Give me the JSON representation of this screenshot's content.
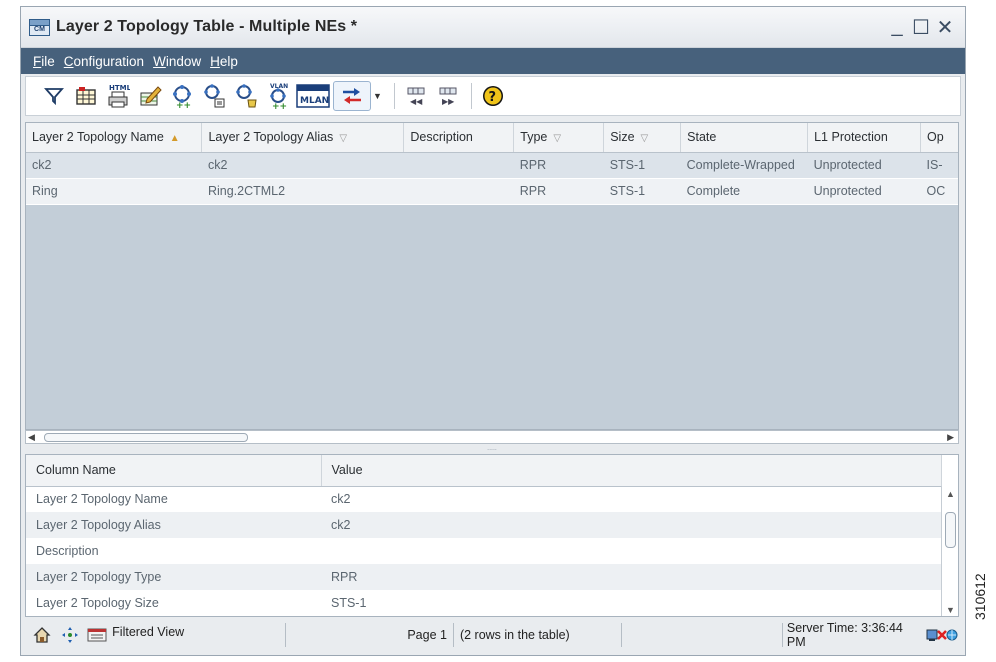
{
  "window": {
    "app_icon_text": "CM",
    "title": "Layer 2 Topology Table - Multiple NEs *",
    "controls": {
      "minimize": "_",
      "maximize": "☐",
      "close": "✕"
    }
  },
  "menu": [
    {
      "label": "File",
      "underline": "F"
    },
    {
      "label": "Configuration",
      "underline": "C"
    },
    {
      "label": "Window",
      "underline": "W"
    },
    {
      "label": "Help",
      "underline": "H"
    }
  ],
  "toolbar": {
    "html_label": "HTML",
    "vlan_label": "VLAN",
    "buttons": [
      "filter-icon",
      "table-icon",
      "html-print-icon",
      "edit-icon",
      "create-ring-icon",
      "ring-detail-icon",
      "ring-modify-icon",
      "vlan-create-icon",
      "mlan-icon",
      "transfer-icon",
      "collapse-columns-icon",
      "expand-columns-icon",
      "help-icon"
    ]
  },
  "topology_table": {
    "columns": [
      {
        "label": "Layer 2 Topology Name",
        "sort": "asc"
      },
      {
        "label": "Layer 2 Topology Alias",
        "sort": "filter"
      },
      {
        "label": "Description",
        "sort": ""
      },
      {
        "label": "Type",
        "sort": "filter"
      },
      {
        "label": "Size",
        "sort": "filter"
      },
      {
        "label": "State",
        "sort": ""
      },
      {
        "label": "L1 Protection",
        "sort": ""
      },
      {
        "label": "Op",
        "sort": ""
      }
    ],
    "rows": [
      [
        "ck2",
        "ck2",
        "",
        "RPR",
        "STS-1",
        "Complete-Wrapped",
        "Unprotected",
        "IS-"
      ],
      [
        "Ring",
        "Ring.2CTML2",
        "",
        "RPR",
        "STS-1",
        "Complete",
        "Unprotected",
        "OC"
      ]
    ]
  },
  "splitter_handle": ".....",
  "detail_table": {
    "columns": [
      "Column Name",
      "Value"
    ],
    "rows": [
      [
        "Layer 2 Topology Name",
        "ck2"
      ],
      [
        "Layer 2 Topology Alias",
        "ck2"
      ],
      [
        "Description",
        ""
      ],
      [
        "Layer 2 Topology Type",
        "RPR"
      ],
      [
        "Layer 2 Topology Size",
        "STS-1"
      ]
    ]
  },
  "statusbar": {
    "filtered_view": "Filtered View",
    "page": "Page 1",
    "row_count": "(2 rows in the table)",
    "server_time": "Server Time: 3:36:44 PM"
  },
  "side_caption": "310612",
  "colors": {
    "menubar": "#47617c",
    "grid_background": "#c3ced8",
    "row_alt": "#dce3ea"
  }
}
